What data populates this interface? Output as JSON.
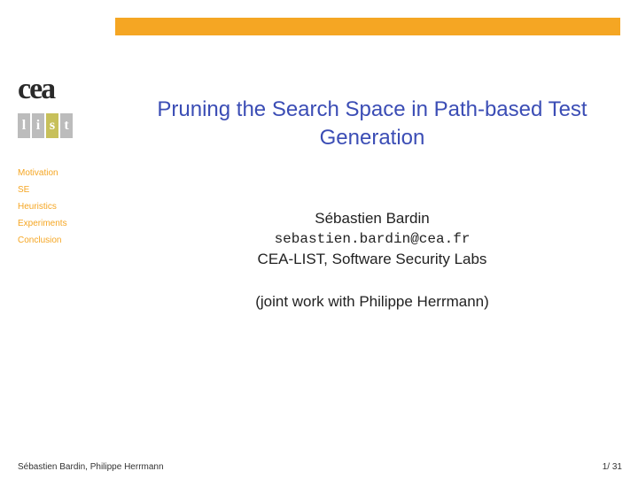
{
  "logo": {
    "cea_text": "cea",
    "list_letters": [
      "l",
      "i",
      "s",
      "t"
    ]
  },
  "nav": {
    "items": [
      "Motivation",
      "SE",
      "Heuristics",
      "Experiments",
      "Conclusion"
    ]
  },
  "title": "Pruning the Search Space in Path-based Test Generation",
  "author": {
    "name": "Sébastien Bardin",
    "email": "sebastien.bardin@cea.fr",
    "affiliation": "CEA-LIST, Software Security Labs"
  },
  "joint": "(joint work with Philippe Herrmann)",
  "footer": {
    "authors": "Sébastien Bardin, Philippe Herrmann",
    "page": "1/ 31"
  }
}
